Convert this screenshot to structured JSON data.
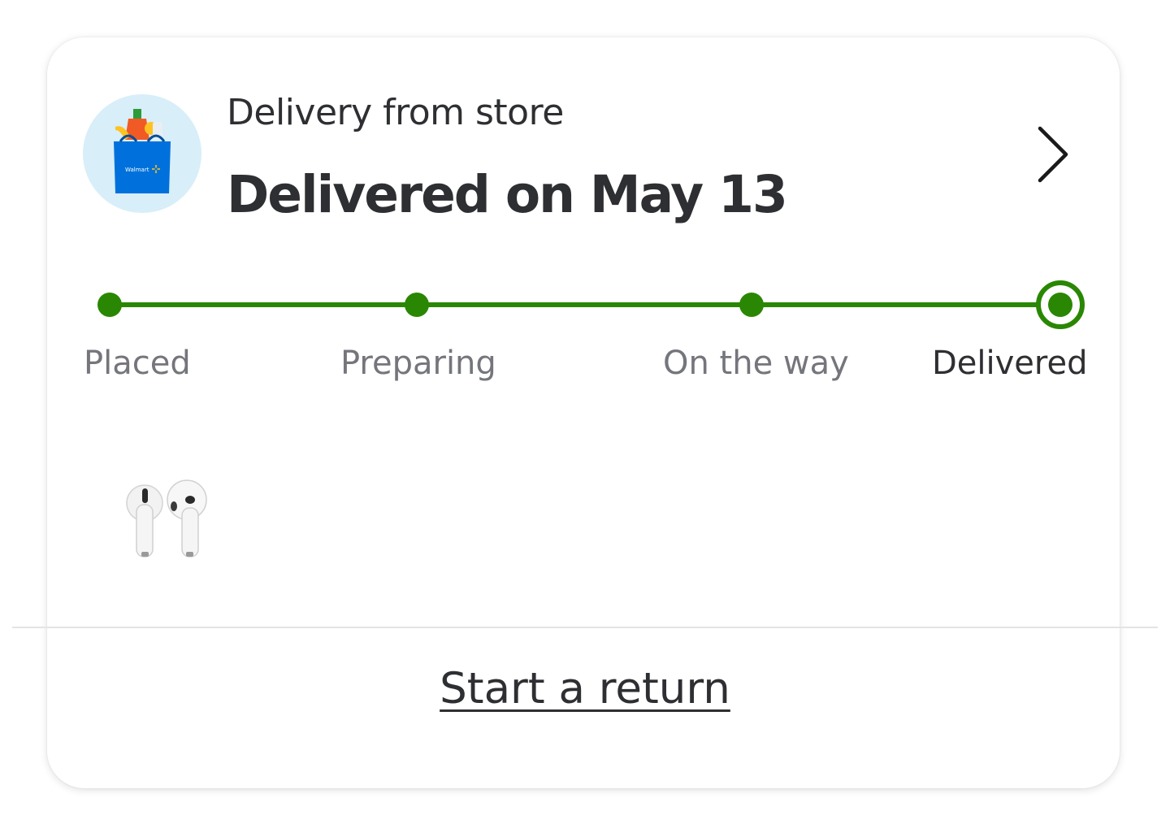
{
  "order": {
    "fulfillment_label": "Delivery from store",
    "status_title": "Delivered on May 13",
    "store_icon": "walmart-bag-icon",
    "bag_brand_text": "Walmart",
    "details_icon": "chevron-right-icon"
  },
  "progress": {
    "steps": [
      {
        "label": "Placed",
        "state": "complete"
      },
      {
        "label": "Preparing",
        "state": "complete"
      },
      {
        "label": "On the way",
        "state": "complete"
      },
      {
        "label": "Delivered",
        "state": "current"
      }
    ],
    "completed_fraction": 1.0
  },
  "items": [
    {
      "icon": "earbuds-product-image"
    }
  ],
  "actions": {
    "start_return_label": "Start a return"
  },
  "colors": {
    "progress_green": "#2a8703",
    "text_primary": "#2e2f32",
    "text_secondary": "#74767c",
    "icon_bg": "#d8eef8",
    "bag_blue": "#0071dc"
  }
}
